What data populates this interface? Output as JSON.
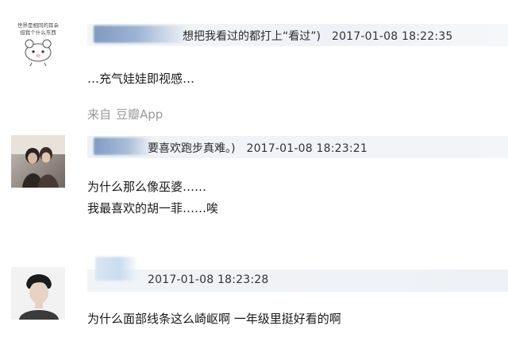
{
  "comments": [
    {
      "reply_quote": "想把我看过的都打上“看过”)",
      "time": "2017-01-08 18:22:35",
      "lines": [
        "…充气娃娃即视感…"
      ],
      "source_prefix": "来自",
      "source_app": "豆瓣App",
      "avatar_caption_1": "世界是相同的耳朵",
      "avatar_caption_2": "但我个什么东西"
    },
    {
      "reply_quote": "要喜欢跑步真难。)",
      "time": "2017-01-08 18:23:21",
      "lines": [
        "为什么那么像巫婆……",
        "我最喜欢的胡一菲……唉"
      ]
    },
    {
      "reply_quote": "",
      "time": "2017-01-08 18:23:28",
      "lines": [
        "为什么面部线条这么崎岖啊 一年级里挺好看的啊"
      ]
    }
  ]
}
